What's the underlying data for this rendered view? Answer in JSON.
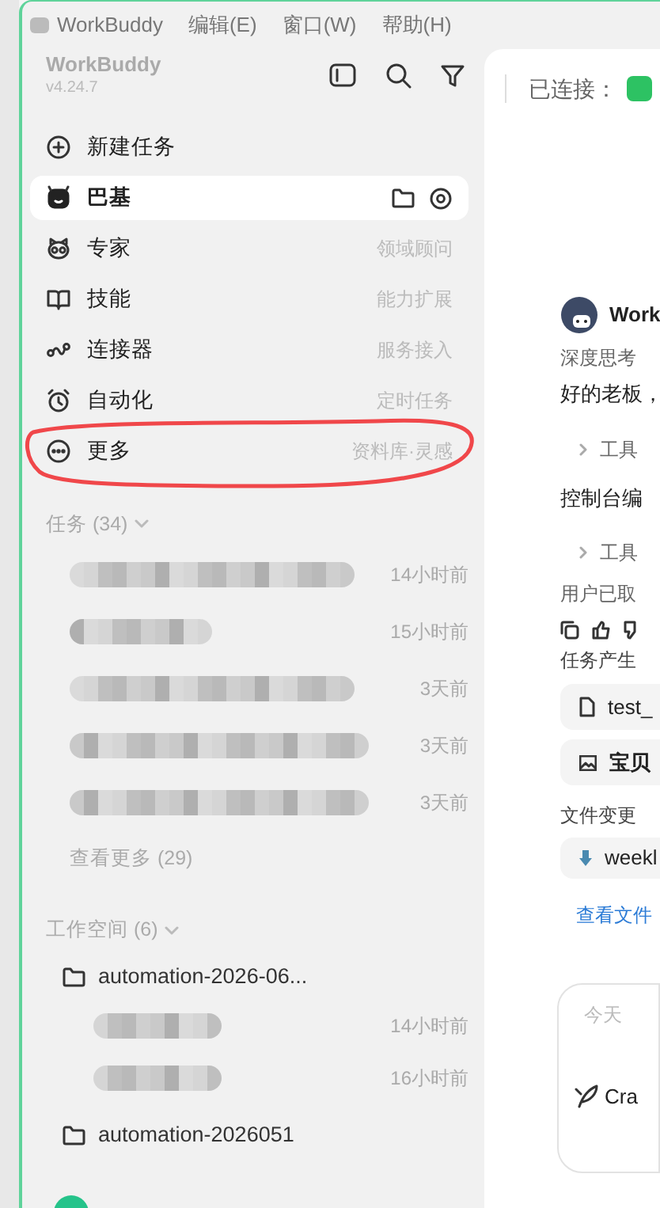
{
  "menu_bar": {
    "app": "WorkBuddy",
    "menus": [
      "编辑(E)",
      "窗口(W)",
      "帮助(H)"
    ]
  },
  "sidebar": {
    "title": "WorkBuddy",
    "version": "v4.24.7",
    "nav": [
      {
        "kind": "new",
        "label": "新建任务",
        "selected": false
      },
      {
        "kind": "agent",
        "label": "巴基",
        "selected": true
      },
      {
        "kind": "expert",
        "label": "专家",
        "hint": "领域顾问",
        "selected": false
      },
      {
        "kind": "skills",
        "label": "技能",
        "hint": "能力扩展",
        "selected": false
      },
      {
        "kind": "connector",
        "label": "连接器",
        "hint": "服务接入",
        "selected": false
      },
      {
        "kind": "automation",
        "label": "自动化",
        "hint": "定时任务",
        "selected": false
      },
      {
        "kind": "more",
        "label": "更多",
        "hint": "资料库·灵感",
        "selected": false,
        "circled": true
      }
    ],
    "tasks_header": "任务 (34)",
    "tasks": [
      {
        "time": "14小时前"
      },
      {
        "time": "15小时前"
      },
      {
        "time": "3天前"
      },
      {
        "time": "3天前"
      },
      {
        "time": "3天前"
      }
    ],
    "see_more": "查看更多 (29)",
    "workspace_header": "工作空间 (6)",
    "workspaces": [
      {
        "name": "automation-2026-06...",
        "children": [
          {
            "time": "14小时前"
          },
          {
            "time": "16小时前"
          }
        ]
      },
      {
        "name": "automation-2026051"
      }
    ]
  },
  "main": {
    "connected_label": "已连接：",
    "sender": "Work",
    "thinking": "深度思考",
    "reply": "好的老板，",
    "blocks": [
      {
        "kind": "tool",
        "text": "工具"
      },
      {
        "kind": "text",
        "text": "控制台编"
      },
      {
        "kind": "tool",
        "text": "工具"
      },
      {
        "kind": "muted",
        "text": "用户已取"
      }
    ],
    "outputs_label": "任务产生",
    "outputs": [
      {
        "kind": "file",
        "name": "test_"
      },
      {
        "kind": "image",
        "name": "宝贝"
      }
    ],
    "changes_label": "文件变更",
    "changes": [
      {
        "name": "weekl"
      }
    ],
    "view_files": "查看文件",
    "input": {
      "placeholder": "今天",
      "mode": "Cra"
    }
  }
}
